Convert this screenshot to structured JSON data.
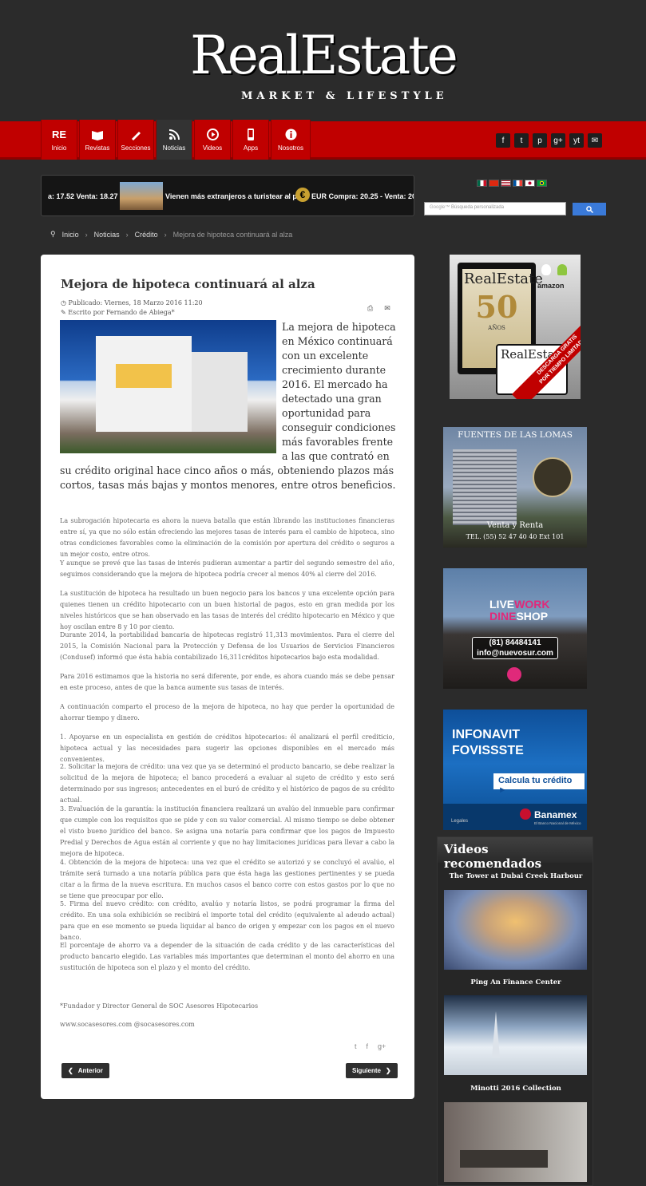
{
  "logo": {
    "main": "RealEstate",
    "sub": "MARKET & LIFESTYLE"
  },
  "nav": [
    {
      "label": "Inicio",
      "icon": "re-logo-icon"
    },
    {
      "label": "Revistas",
      "icon": "book-icon"
    },
    {
      "label": "Secciones",
      "icon": "pen-icon"
    },
    {
      "label": "Noticias",
      "icon": "rss-icon"
    },
    {
      "label": "Videos",
      "icon": "play-icon"
    },
    {
      "label": "Apps",
      "icon": "phone-icon"
    },
    {
      "label": "Nosotros",
      "icon": "info-icon"
    }
  ],
  "social": [
    "f",
    "t",
    "p",
    "g+",
    "yt",
    "✉"
  ],
  "ticker": {
    "left": "a: 17.52 Venta: 18.27",
    "headline": "Vienen más extranjeros a turistear al país",
    "eur": "EUR Compra: 20.25 - Venta: 20.8"
  },
  "search": {
    "placeholder": "Búsqueda personalizada"
  },
  "breadcrumb": {
    "home": "Inicio",
    "noticias": "Noticias",
    "credito": "Crédito",
    "current": "Mejora de hipoteca continuará al alza"
  },
  "article": {
    "title": "Mejora de hipoteca continuará al alza",
    "published": "Publicado: Viernes, 18 Marzo 2016 11:20",
    "author": "Escrito por Fernando de Abiega*",
    "lead": "La mejora de hipoteca en México continuará con un excelente crecimiento durante 2016. El mercado ha detectado una gran oportunidad para conseguir condiciones más favorables frente a las que contrató en su crédito original hace cinco años o más, obteniendo plazos más cortos, tasas más bajas y montos menores, entre otros beneficios.",
    "paragraphs": [
      "La subrogación hipotecaria es ahora la nueva batalla que están librando las instituciones financieras entre sí, ya que no sólo están ofreciendo las mejores tasas de interés para el cambio de hipoteca, sino otras condiciones favorables como la eliminación de la comisión por apertura del crédito o seguros a un mejor costo, entre otros.",
      "Y aunque se prevé que las tasas de interés pudieran aumentar a partir del segundo semestre del año, seguimos considerando que la mejora de hipoteca podría crecer al menos 40% al cierre del 2016.",
      "La sustitución de hipoteca ha resultado un buen negocio para los bancos y una excelente opción para quienes tienen un crédito hipotecario con un buen historial de pagos, esto en gran medida por los niveles históricos que se han observado en las tasas de interés del crédito hipotecario en México y que hoy oscilan entre 8 y 10 por ciento.",
      "Durante 2014, la portabilidad bancaria de hipotecas registró 11,313 movimientos. Para el cierre del 2015, la Comisión Nacional para la Protección y Defensa de los Usuarios de Servicios Financieros (Condusef) informó que ésta había contabilizado 16,311créditos hipotecarios bajo esta modalidad.",
      "Para 2016 estimamos que la historia no será diferente, por ende, es ahora cuando más se debe pensar en este proceso, antes de que la banca aumente sus tasas de interés.",
      "A continuación comparto el proceso de la mejora de hipoteca, no hay que perder la oportunidad de ahorrar tiempo y dinero.",
      "1.        Apoyarse en un especialista en gestión de créditos hipotecarios: él analizará el perfil crediticio, hipoteca actual y las necesidades para sugerir las opciones disponibles en el mercado más convenientes.",
      "2.        Solicitar la mejora de crédito: una vez que ya se determinó el producto bancario, se debe realizar la solicitud de la mejora de hipoteca; el banco procederá a evaluar  al sujeto de crédito y esto será determinado por sus ingresos; antecedentes en el buró de crédito y  el histórico de pagos de su crédito actual.",
      "3.        Evaluación de la garantía: la institución financiera realizará un avalúo del inmueble para confirmar que cumple con los requisitos que se pide y con su valor comercial. Al mismo tiempo se debe obtener el visto bueno jurídico del banco. Se asigna una notaría para  confirmar que los pagos de Impuesto Predial y Derechos de Agua están al corriente y que no hay limitaciones jurídicas para llevar a cabo la mejora de hipoteca.",
      "4.        Obtención de la mejora de hipoteca: una vez que el crédito se autorizó y se concluyó el avalúo, el trámite será turnado a una notaría pública para que ésta haga las gestiones pertinentes y se pueda citar a la firma de la nueva escritura. En muchos casos el banco corre con estos gastos por lo que no se tiene que preocupar por ello.",
      "5.        Firma del nuevo crédito: con crédito, avalúo y notaría listos, se podrá programar la firma del crédito. En una sola exhibición se recibirá el importe total del crédito (equivalente al adeudo actual) para que en ese momento se pueda liquidar al banco de origen y empezar con los pagos en el nuevo banco.",
      "El porcentaje de ahorro va a depender de la situación de cada crédito y de las características del producto bancario elegido. Las variables más importantes que determinan el monto del ahorro en una sustitución de hipoteca son el plazo y el monto del crédito."
    ],
    "footnote": "*Fundador y Director General de SOC Asesores Hipotecarios",
    "links": "www.socasesores.com @socasesores.com",
    "prev": "Anterior",
    "next": "Siguiente"
  },
  "ads": {
    "magazine": {
      "brand": "RealEstate",
      "years": "50",
      "unit": "AÑOS",
      "cta": "DESCARGA GRATIS",
      "cta2": "POR TIEMPO LIMITADO",
      "store": "amazon"
    },
    "fuentes": {
      "title": "FUENTES DE LAS LOMAS",
      "sub": "Venta y Renta",
      "tel": "TEL. (55) 52 47 40 40 Ext 101"
    },
    "nuevosur": {
      "l1": "LIVE",
      "l2": "WORK",
      "l3": "DINE",
      "l4": "SHOP",
      "phone": "(81) 84484141",
      "email": "info@nuevosur.com"
    },
    "banamex": {
      "l1": "INFONAVIT",
      "l2": "FOVISSSTE",
      "cta": "Calcula tu crédito ►",
      "legal": "Legales",
      "brand": "Banamex",
      "tag": "El Banco Nacional de México"
    }
  },
  "videos": {
    "heading": "Videos recomendados",
    "items": [
      "The Tower at Dubai Creek Harbour",
      "Ping An Finance Center",
      "Minotti 2016 Collection"
    ]
  },
  "colors": {
    "red": "#c00000",
    "bg": "#2b2b2b",
    "accent": "#3a7ad9"
  }
}
